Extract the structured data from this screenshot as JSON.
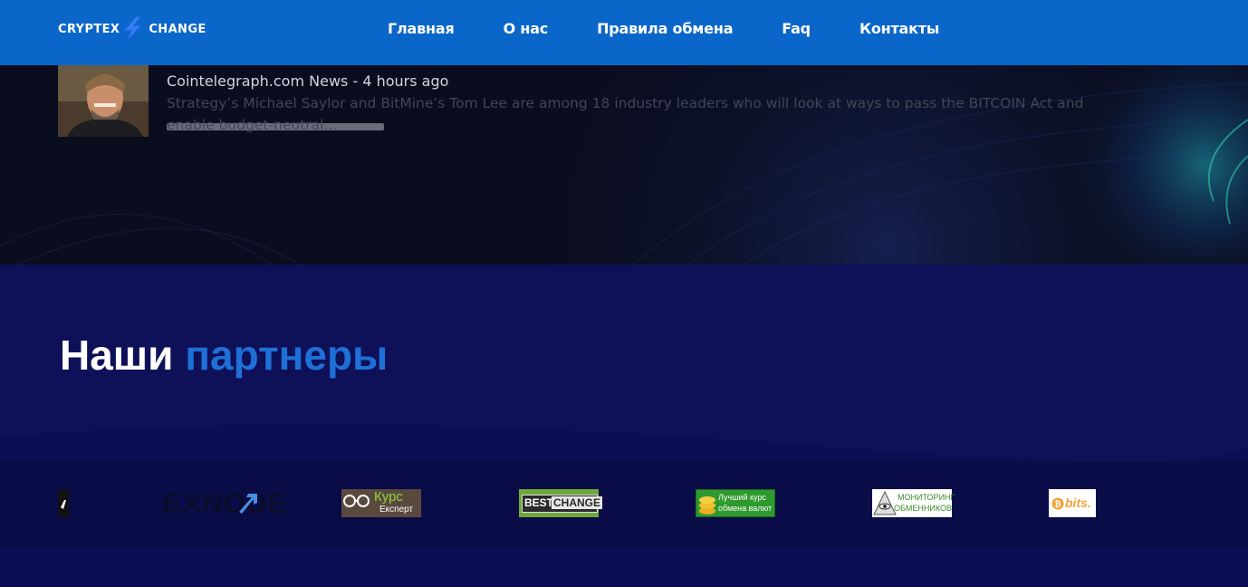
{
  "header": {
    "logo_left": "CRYPTEX",
    "logo_right": "CHANGE",
    "nav": [
      {
        "label": "Главная"
      },
      {
        "label": "О нас"
      },
      {
        "label": "Правила обмена"
      },
      {
        "label": "Faq"
      },
      {
        "label": "Контакты"
      }
    ]
  },
  "news": {
    "source_time": "Cointelegraph.com News - 4 hours ago",
    "excerpt": "Strategy’s Michael Saylor and BitMine’s Tom Lee are among 18 industry leaders who will look at ways to pass the BITCOIN Act and enable budget-neutral..."
  },
  "partners": {
    "title_white": "Наши",
    "title_accent": "партнеры",
    "logos": [
      {
        "name": "exnode",
        "text": "EXNODE"
      },
      {
        "name": "kurs-expert",
        "text_top": "Курс",
        "text_bottom": "Експерт"
      },
      {
        "name": "bestchange",
        "text_a": "BEST",
        "text_b": "CHANGE"
      },
      {
        "name": "best-rate",
        "text_top": "Лучший курс",
        "text_bottom": "обмена валют"
      },
      {
        "name": "monitoring",
        "text_top": "МОНИТОРИНГ",
        "text_bottom": "ОБМЕННИКОВ"
      },
      {
        "name": "bits",
        "text": "bits."
      }
    ]
  },
  "colors": {
    "header_bg": "#0a67c9",
    "accent": "#1e6fd6",
    "section_bg": "#0e1058"
  }
}
